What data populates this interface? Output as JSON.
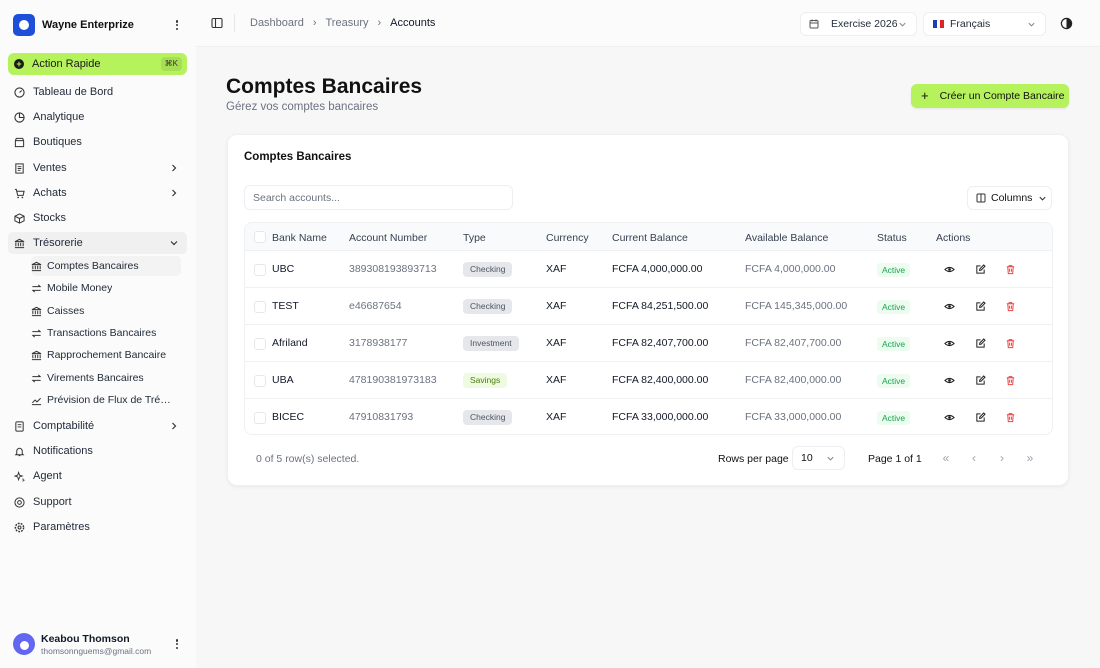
{
  "app": {
    "org_name": "Wayne Enterprize"
  },
  "sidebar": {
    "quick_action": {
      "label": "Action Rapide",
      "shortcut": "⌘K"
    },
    "items": [
      {
        "label": "Tableau de Bord",
        "icon": "gauge-icon"
      },
      {
        "label": "Analytique",
        "icon": "pie-chart-icon"
      },
      {
        "label": "Boutiques",
        "icon": "store-icon"
      },
      {
        "label": "Ventes",
        "icon": "receipt-icon",
        "expandable": true
      },
      {
        "label": "Achats",
        "icon": "cart-icon",
        "expandable": true
      },
      {
        "label": "Stocks",
        "icon": "box-icon"
      },
      {
        "label": "Trésorerie",
        "icon": "bank-icon",
        "expandable": true,
        "expanded": true
      },
      {
        "label": "Comptabilité",
        "icon": "ledger-icon",
        "expandable": true
      },
      {
        "label": "Notifications",
        "icon": "bell-icon"
      },
      {
        "label": "Agent",
        "icon": "sparkles-icon"
      },
      {
        "label": "Support",
        "icon": "help-icon"
      },
      {
        "label": "Paramètres",
        "icon": "gear-icon"
      }
    ],
    "treasury_sub": [
      {
        "label": "Comptes Bancaires",
        "icon": "bank-icon",
        "active": true
      },
      {
        "label": "Mobile Money",
        "icon": "arrows-icon"
      },
      {
        "label": "Caisses",
        "icon": "bank-icon"
      },
      {
        "label": "Transactions Bancaires",
        "icon": "arrows-icon"
      },
      {
        "label": "Rapprochement Bancaire",
        "icon": "bank-icon"
      },
      {
        "label": "Virements Bancaires",
        "icon": "arrows-icon"
      },
      {
        "label": "Prévision de Flux de Trés...",
        "icon": "trend-icon"
      }
    ],
    "user": {
      "name": "Keabou Thomson",
      "email": "thomsonnguems@gmail.com"
    }
  },
  "header": {
    "breadcrumb": [
      "Dashboard",
      "Treasury",
      "Accounts"
    ],
    "fiscal_year": "Exercise 2026",
    "language": "Français"
  },
  "page": {
    "title": "Comptes Bancaires",
    "subtitle": "Gérez vos comptes bancaires",
    "create_button": "Créer un Compte Bancaire"
  },
  "card": {
    "title": "Comptes Bancaires",
    "search_placeholder": "Search accounts...",
    "columns_button": "Columns"
  },
  "table": {
    "headers": [
      "Bank Name",
      "Account Number",
      "Type",
      "Currency",
      "Current Balance",
      "Available Balance",
      "Status",
      "Actions"
    ],
    "rows": [
      {
        "bank": "UBC",
        "account": "389308193893713",
        "type": "Checking",
        "currency": "XAF",
        "current": "FCFA 4,000,000.00",
        "available": "FCFA 4,000,000.00",
        "status": "Active"
      },
      {
        "bank": "TEST",
        "account": "e46687654",
        "type": "Checking",
        "currency": "XAF",
        "current": "FCFA 84,251,500.00",
        "available": "FCFA 145,345,000.00",
        "status": "Active"
      },
      {
        "bank": "Afriland",
        "account": "3178938177",
        "type": "Investment",
        "currency": "XAF",
        "current": "FCFA 82,407,700.00",
        "available": "FCFA 82,407,700.00",
        "status": "Active"
      },
      {
        "bank": "UBA",
        "account": "478190381973183",
        "type": "Savings",
        "currency": "XAF",
        "current": "FCFA 82,400,000.00",
        "available": "FCFA 82,400,000.00",
        "status": "Active"
      },
      {
        "bank": "BICEC",
        "account": "47910831793",
        "type": "Checking",
        "currency": "XAF",
        "current": "FCFA 33,000,000.00",
        "available": "FCFA 33,000,000.00",
        "status": "Active"
      }
    ]
  },
  "footer": {
    "selection": "0 of 5 row(s) selected.",
    "rows_per_page_label": "Rows per page",
    "rows_per_page_value": "10",
    "page_info": "Page 1 of 1"
  },
  "colors": {
    "accent": "#b5f25b",
    "brand": "#1e4fd8",
    "active_status": "#16a34a",
    "delete": "#ef4444"
  }
}
